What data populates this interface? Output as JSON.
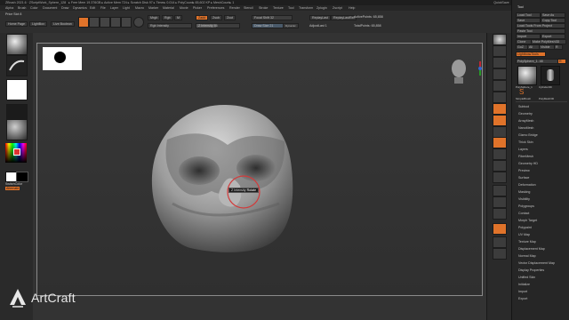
{
  "titlebar": {
    "title": "ZBrush 2021.6",
    "doc": "ZScriptWork_Sphere_128",
    "stats": "▸ Free Mem 19.376GB ▸ Active Mem 724 ▸ Scratch Disk 97 ▸ Timer▸ 0.014 ▸ PolyCount▸ 65,602 KP ▸ MeshCount▸ 1",
    "quicksave": "QuickSave",
    "see_through": "See-through 0",
    "menus_label": "Menus",
    "default_zscript": "DefaultZScript"
  },
  "menubar": [
    "Alpha",
    "Brush",
    "Color",
    "Document",
    "Draw",
    "Dynamics",
    "Edit",
    "File",
    "Layer",
    "Light",
    "Macro",
    "Marker",
    "Material",
    "Movie",
    "Picker",
    "Preferences",
    "Render",
    "Stencil",
    "Stroke",
    "Texture",
    "Tool",
    "Transform",
    "Zplugin",
    "Zscript",
    "Help"
  ],
  "toolbar": {
    "home_page": "Home Page",
    "lightbox": "LightBox",
    "live_boolean": "Live Boolean",
    "edit": "Edit",
    "draw": "Draw",
    "move": "Move",
    "scale": "Scale",
    "rotate": "Rotate",
    "mrgb": "Mrgb",
    "rgb": "Rgb",
    "m": "M",
    "zadd": "Zadd",
    "zsub": "Zsub",
    "zcut": "Zcut",
    "rgb_intensity": "Rgb Intensity",
    "z_intensity": "Z Intensity 46",
    "focal_shift": "Focal Shift 32",
    "draw_size": "Draw Size 21",
    "dynamic": "Dynamic",
    "rgb_intensity_value": "RGB Intensity 100",
    "active_points": "ActivePoints: 65,858",
    "total_points": "TotalPoints: 65,858",
    "replay_last": "ReplayLast",
    "replay_last_rel": "ReplayLastRel",
    "adjust_last": "AdjustLast 1"
  },
  "leftshelf": {
    "brush_label": "Standard",
    "stroke_label": "DragRect",
    "alpha_label": "Alpha Off",
    "texture_label": "Texture Off",
    "material_label": "MatCap Gray",
    "gradient": "Gradient",
    "switch_color": "SwitchColor",
    "alternate": "Alternate",
    "price_slot": "Price Slot 8"
  },
  "canvas": {
    "brush_tip_label": "Z Intensity",
    "brush_tip_value": "Rotate"
  },
  "rightshelf": [
    "BPR",
    "SPix 3",
    "Scroll",
    "Zoom",
    "Actual",
    "AAHalf",
    "Persp",
    "Floor",
    "Local",
    "Frame",
    "Move",
    "Zoom3D",
    "Rotate",
    "Line Fill",
    "PolyF",
    "Transp",
    "Ghost",
    "Solo",
    "Xpose"
  ],
  "tray": {
    "title": "Tool",
    "buttons": [
      [
        "Load Tool",
        "Save As"
      ],
      [
        "Save",
        "Copy Tool"
      ],
      [
        "Load Tools From Project"
      ],
      [
        "Paste Tool"
      ],
      [
        "Import",
        "Export"
      ],
      [
        "Clone",
        "Make PolyMesh3D"
      ],
      [
        "GoZ",
        "All",
        "Visible",
        "R"
      ],
      [
        "Lightbox▸Tools"
      ]
    ],
    "current_tool": "PolySphere_1. 48",
    "r_button": "R",
    "thumb_labels": [
      "PolySphere_1",
      "Cylinder3D",
      "SimpleBrush",
      "PolyMesh3D"
    ],
    "sections": [
      "Subtool",
      "Geometry",
      "ArrayMesh",
      "NanoMesh",
      "Gizmo Bridge",
      "Thick Skin",
      "Layers",
      "FiberMesh",
      "Geometry HD",
      "Preview",
      "Surface",
      "Deformation",
      "Masking",
      "Visibility",
      "Polygroups",
      "Contact",
      "Morph Target",
      "Polypaint",
      "UV Map",
      "Texture Map",
      "Displacement Map",
      "Normal Map",
      "Vector Displacement Map",
      "Display Properties",
      "Unified Skin",
      "Initialize",
      "Import",
      "Export"
    ]
  },
  "logo": {
    "name": "ArtCraft"
  },
  "colors": {
    "accent": "#e0732a",
    "bg": "#2b2b2b",
    "canvas": "#333333"
  }
}
